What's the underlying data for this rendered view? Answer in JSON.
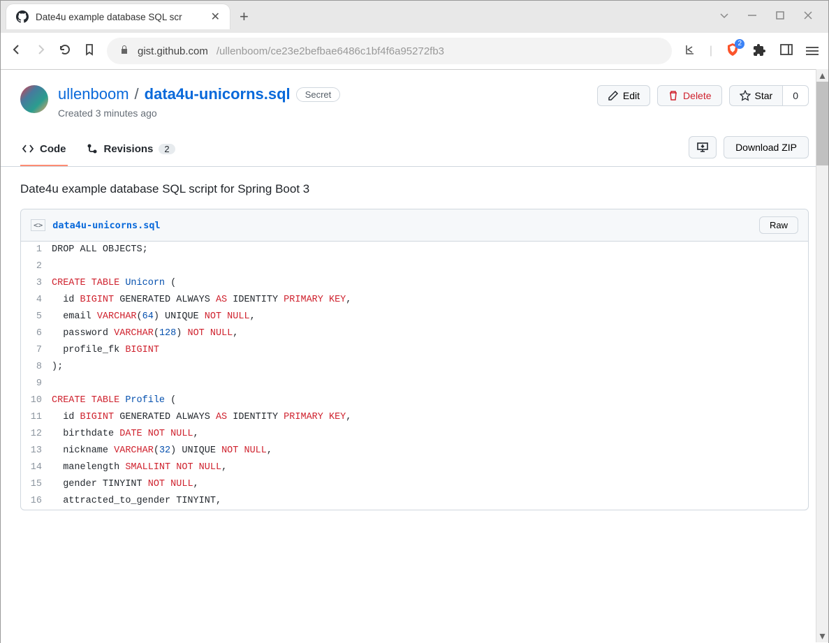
{
  "browser": {
    "tab_title": "Date4u example database SQL scr",
    "url_host": "gist.github.com",
    "url_path": "/ullenboom/ce23e2befbae6486c1bf4f6a95272fb3",
    "brave_count": "2"
  },
  "gist": {
    "owner": "ullenboom",
    "name": "data4u-unicorns.sql",
    "secret_label": "Secret",
    "created": "Created 3 minutes ago",
    "edit_label": "Edit",
    "delete_label": "Delete",
    "star_label": "Star",
    "star_count": "0"
  },
  "tabs": {
    "code_label": "Code",
    "revisions_label": "Revisions",
    "revisions_count": "2",
    "download_zip": "Download ZIP"
  },
  "description": "Date4u example database SQL script for Spring Boot 3",
  "file": {
    "name": "data4u-unicorns.sql",
    "raw_label": "Raw"
  },
  "code_lines": [
    [
      {
        "t": "DROP",
        "c": ""
      },
      {
        "t": " ALL OBJECTS;",
        "c": ""
      }
    ],
    [],
    [
      {
        "t": "CREATE TABLE",
        "c": "kw"
      },
      {
        "t": " ",
        "c": ""
      },
      {
        "t": "Unicorn",
        "c": "type"
      },
      {
        "t": " (",
        "c": ""
      }
    ],
    [
      {
        "t": "  id ",
        "c": ""
      },
      {
        "t": "BIGINT",
        "c": "kw"
      },
      {
        "t": " GENERATED ALWAYS ",
        "c": ""
      },
      {
        "t": "AS",
        "c": "kw"
      },
      {
        "t": " IDENTITY ",
        "c": ""
      },
      {
        "t": "PRIMARY KEY",
        "c": "kw"
      },
      {
        "t": ",",
        "c": ""
      }
    ],
    [
      {
        "t": "  email ",
        "c": ""
      },
      {
        "t": "VARCHAR",
        "c": "kw"
      },
      {
        "t": "(",
        "c": ""
      },
      {
        "t": "64",
        "c": "num"
      },
      {
        "t": ") UNIQUE ",
        "c": ""
      },
      {
        "t": "NOT NULL",
        "c": "kw"
      },
      {
        "t": ",",
        "c": ""
      }
    ],
    [
      {
        "t": "  password ",
        "c": ""
      },
      {
        "t": "VARCHAR",
        "c": "kw"
      },
      {
        "t": "(",
        "c": ""
      },
      {
        "t": "128",
        "c": "num"
      },
      {
        "t": ") ",
        "c": ""
      },
      {
        "t": "NOT NULL",
        "c": "kw"
      },
      {
        "t": ",",
        "c": ""
      }
    ],
    [
      {
        "t": "  profile_fk ",
        "c": ""
      },
      {
        "t": "BIGINT",
        "c": "kw"
      }
    ],
    [
      {
        "t": ");",
        "c": ""
      }
    ],
    [],
    [
      {
        "t": "CREATE TABLE",
        "c": "kw"
      },
      {
        "t": " ",
        "c": ""
      },
      {
        "t": "Profile",
        "c": "type"
      },
      {
        "t": " (",
        "c": ""
      }
    ],
    [
      {
        "t": "  id ",
        "c": ""
      },
      {
        "t": "BIGINT",
        "c": "kw"
      },
      {
        "t": " GENERATED ALWAYS ",
        "c": ""
      },
      {
        "t": "AS",
        "c": "kw"
      },
      {
        "t": " IDENTITY ",
        "c": ""
      },
      {
        "t": "PRIMARY KEY",
        "c": "kw"
      },
      {
        "t": ",",
        "c": ""
      }
    ],
    [
      {
        "t": "  birthdate ",
        "c": ""
      },
      {
        "t": "DATE NOT NULL",
        "c": "kw"
      },
      {
        "t": ",",
        "c": ""
      }
    ],
    [
      {
        "t": "  nickname ",
        "c": ""
      },
      {
        "t": "VARCHAR",
        "c": "kw"
      },
      {
        "t": "(",
        "c": ""
      },
      {
        "t": "32",
        "c": "num"
      },
      {
        "t": ") UNIQUE ",
        "c": ""
      },
      {
        "t": "NOT NULL",
        "c": "kw"
      },
      {
        "t": ",",
        "c": ""
      }
    ],
    [
      {
        "t": "  manelength ",
        "c": ""
      },
      {
        "t": "SMALLINT NOT NULL",
        "c": "kw"
      },
      {
        "t": ",",
        "c": ""
      }
    ],
    [
      {
        "t": "  gender TINYINT ",
        "c": ""
      },
      {
        "t": "NOT NULL",
        "c": "kw"
      },
      {
        "t": ",",
        "c": ""
      }
    ],
    [
      {
        "t": "  attracted_to_gender TINYINT,",
        "c": ""
      }
    ]
  ]
}
